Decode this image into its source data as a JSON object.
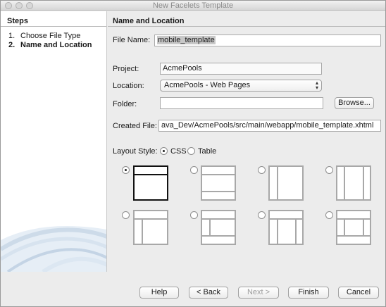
{
  "window": {
    "title": "New Facelets Template"
  },
  "steps": {
    "title": "Steps",
    "items": [
      {
        "num": "1.",
        "label": "Choose File Type"
      },
      {
        "num": "2.",
        "label": "Name and Location"
      }
    ]
  },
  "section": {
    "title": "Name and Location"
  },
  "form": {
    "file_name_label": "File Name:",
    "file_name_value": "mobile_template",
    "project_label": "Project:",
    "project_value": "AcmePools",
    "location_label": "Location:",
    "location_value": "AcmePools - Web Pages",
    "folder_label": "Folder:",
    "folder_value": "",
    "browse_label": "Browse...",
    "created_file_label": "Created File:",
    "created_file_value": "ava_Dev/AcmePools/src/main/webapp/mobile_template.xhtml",
    "layout_style_label": "Layout Style:",
    "layout_style_options": [
      "CSS",
      "Table"
    ],
    "layout_style_selected": "CSS"
  },
  "layouts": {
    "selected_index": 0,
    "count": 8
  },
  "buttons": {
    "help": "Help",
    "back": "< Back",
    "next": "Next >",
    "finish": "Finish",
    "cancel": "Cancel"
  }
}
